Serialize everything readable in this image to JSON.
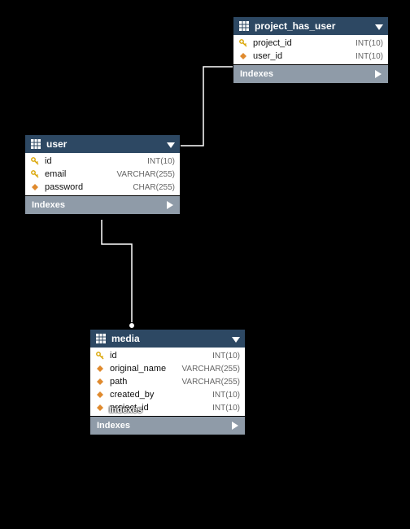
{
  "tables": {
    "project_has_user": {
      "title": "project_has_user",
      "columns": [
        {
          "icon": "key",
          "name": "project_id",
          "type": "INT(10)"
        },
        {
          "icon": "diamond",
          "name": "user_id",
          "type": "INT(10)"
        }
      ],
      "indexes_label": "Indexes"
    },
    "user": {
      "title": "user",
      "columns": [
        {
          "icon": "key",
          "name": "id",
          "type": "INT(10)"
        },
        {
          "icon": "key",
          "name": "email",
          "type": "VARCHAR(255)"
        },
        {
          "icon": "diamond",
          "name": "password",
          "type": "CHAR(255)"
        }
      ],
      "indexes_label": "Indexes"
    },
    "media": {
      "title": "media",
      "columns": [
        {
          "icon": "key",
          "name": "id",
          "type": "INT(10)"
        },
        {
          "icon": "diamond",
          "name": "original_name",
          "type": "VARCHAR(255)"
        },
        {
          "icon": "diamond",
          "name": "path",
          "type": "VARCHAR(255)"
        },
        {
          "icon": "diamond",
          "name": "created_by",
          "type": "INT(10)"
        },
        {
          "icon": "diamond",
          "name": "project_id",
          "type": "INT(10)"
        }
      ],
      "indexes_label": "Indexes",
      "overlay_label": "Indexes"
    }
  },
  "chart_data": {
    "type": "erd",
    "entities": [
      {
        "name": "project_has_user",
        "columns": [
          {
            "name": "project_id",
            "type": "INT(10)",
            "key": "FK"
          },
          {
            "name": "user_id",
            "type": "INT(10)",
            "key": "FK"
          }
        ]
      },
      {
        "name": "user",
        "columns": [
          {
            "name": "id",
            "type": "INT(10)",
            "key": "PK"
          },
          {
            "name": "email",
            "type": "VARCHAR(255)",
            "key": "PK"
          },
          {
            "name": "password",
            "type": "CHAR(255)",
            "key": ""
          }
        ]
      },
      {
        "name": "media",
        "columns": [
          {
            "name": "id",
            "type": "INT(10)",
            "key": "PK"
          },
          {
            "name": "original_name",
            "type": "VARCHAR(255)",
            "key": ""
          },
          {
            "name": "path",
            "type": "VARCHAR(255)",
            "key": ""
          },
          {
            "name": "created_by",
            "type": "INT(10)",
            "key": "FK"
          },
          {
            "name": "project_id",
            "type": "INT(10)",
            "key": "FK"
          }
        ]
      }
    ],
    "relationships": [
      {
        "from": "project_has_user.user_id",
        "to": "user.id"
      },
      {
        "from": "media.created_by",
        "to": "user.id"
      }
    ]
  }
}
